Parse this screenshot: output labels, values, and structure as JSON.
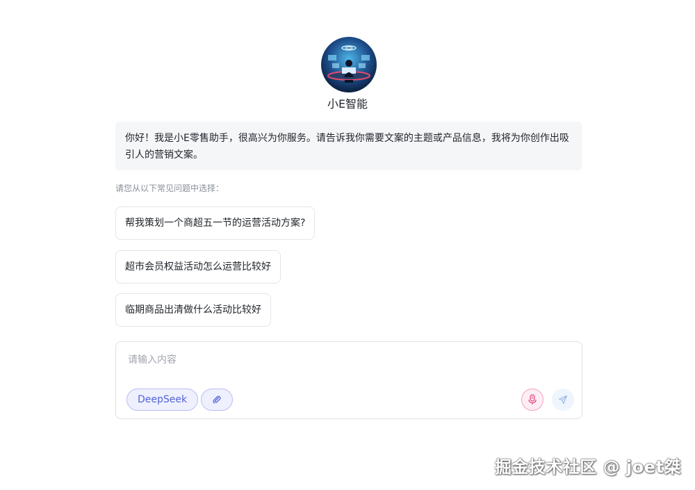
{
  "bot": {
    "name": "小E智能",
    "avatar_icon": "robot-operator-avatar-icon"
  },
  "greeting": "你好！我是小E零售助手，很高兴为你服务。请告诉我你需要文案的主题或产品信息，我将为你创作出吸引人的营销文案。",
  "suggestions": {
    "hint": "请您从以下常见问题中选择：",
    "items": [
      "帮我策划一个商超五一节的运营活动方案?",
      "超市会员权益活动怎么运营比较好",
      "临期商品出清做什么活动比较好"
    ]
  },
  "composer": {
    "placeholder": "请输入内容",
    "model_label": "DeepSeek",
    "attach_icon": "paperclip-icon",
    "mic_icon": "microphone-icon",
    "send_icon": "send-icon"
  },
  "colors": {
    "accent": "#5561d8",
    "mic": "#e0508a",
    "send": "#9ab8e6"
  },
  "watermark": "掘金技术社区 @ joet桀"
}
